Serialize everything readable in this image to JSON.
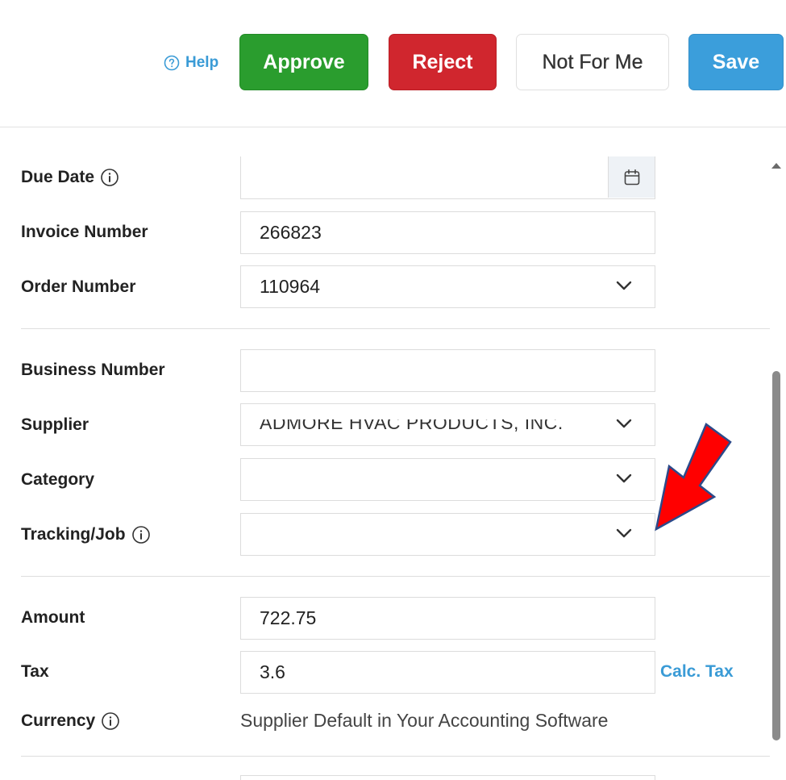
{
  "toolbar": {
    "help_label": "Help",
    "approve_label": "Approve",
    "reject_label": "Reject",
    "not_for_me_label": "Not For Me",
    "save_label": "Save"
  },
  "form": {
    "due_date": {
      "label": "Due Date",
      "value": ""
    },
    "invoice_number": {
      "label": "Invoice Number",
      "value": "266823"
    },
    "order_number": {
      "label": "Order Number",
      "value": "110964"
    },
    "business_number": {
      "label": "Business Number",
      "value": ""
    },
    "supplier": {
      "label": "Supplier",
      "value": "ADMORE HVAC PRODUCTS, INC."
    },
    "category": {
      "label": "Category",
      "value": ""
    },
    "tracking_job": {
      "label": "Tracking/Job",
      "value": ""
    },
    "amount": {
      "label": "Amount",
      "value": "722.75"
    },
    "tax": {
      "label": "Tax",
      "value": "3.6",
      "action_label": "Calc. Tax"
    },
    "currency": {
      "label": "Currency",
      "value": "Supplier Default in Your Accounting Software"
    }
  },
  "icons": {
    "help": "question-circle-icon",
    "info": "info-circle-icon",
    "calendar": "calendar-icon",
    "dropdown": "chevron-down-icon",
    "annotation": "red-arrow-icon"
  },
  "colors": {
    "approve": "#2a9d2e",
    "reject": "#d0262e",
    "save": "#3b9edb",
    "link": "#3a9bd6",
    "annotation_arrow": "#ff0000"
  }
}
